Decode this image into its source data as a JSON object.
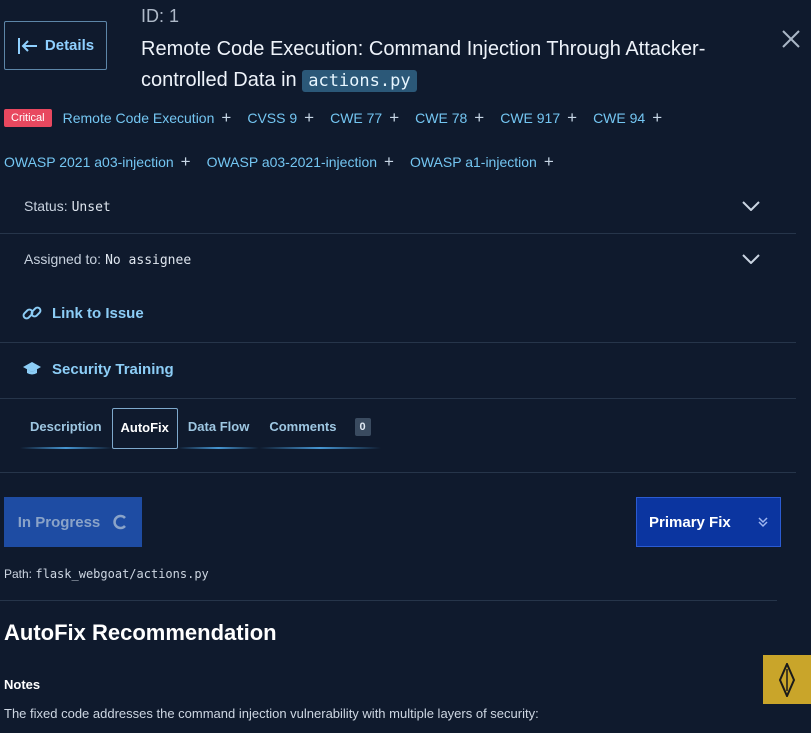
{
  "header": {
    "back_label": "Details",
    "id_text": "ID: 1",
    "title_text": "Remote Code Execution: Command Injection Through Attacker-controlled Data in",
    "title_file": "actions.py"
  },
  "tags": {
    "severity": "Critical",
    "items": [
      "Remote Code Execution",
      "CVSS 9",
      "CWE 77",
      "CWE 78",
      "CWE 917",
      "CWE 94",
      "OWASP 2021 a03-injection",
      "OWASP a03-2021-injection",
      "OWASP a1-injection"
    ]
  },
  "status": {
    "label": "Status:",
    "value": "Unset"
  },
  "assigned": {
    "label": "Assigned to:",
    "value": "No assignee"
  },
  "links": {
    "issue": "Link to Issue",
    "training": "Security Training"
  },
  "tabs": {
    "items": [
      "Description",
      "AutoFix",
      "Data Flow",
      "Comments"
    ],
    "active": "AutoFix",
    "comments_count": "0"
  },
  "actions": {
    "progress_label": "In Progress",
    "primary_fix_label": "Primary Fix"
  },
  "path": {
    "label": "Path:",
    "value": "flask_webgoat/actions.py"
  },
  "recommendation": {
    "title": "AutoFix Recommendation",
    "notes_heading": "Notes",
    "notes_text": "The fixed code addresses the command injection vulnerability with multiple layers of security:"
  },
  "colors": {
    "background": "#0f1a2d",
    "accent_link": "#74c6f2",
    "critical": "#e8485f",
    "primary_button": "#0b35a0",
    "progress_button": "#1e4ca3",
    "floating_button": "#c9a52a"
  }
}
